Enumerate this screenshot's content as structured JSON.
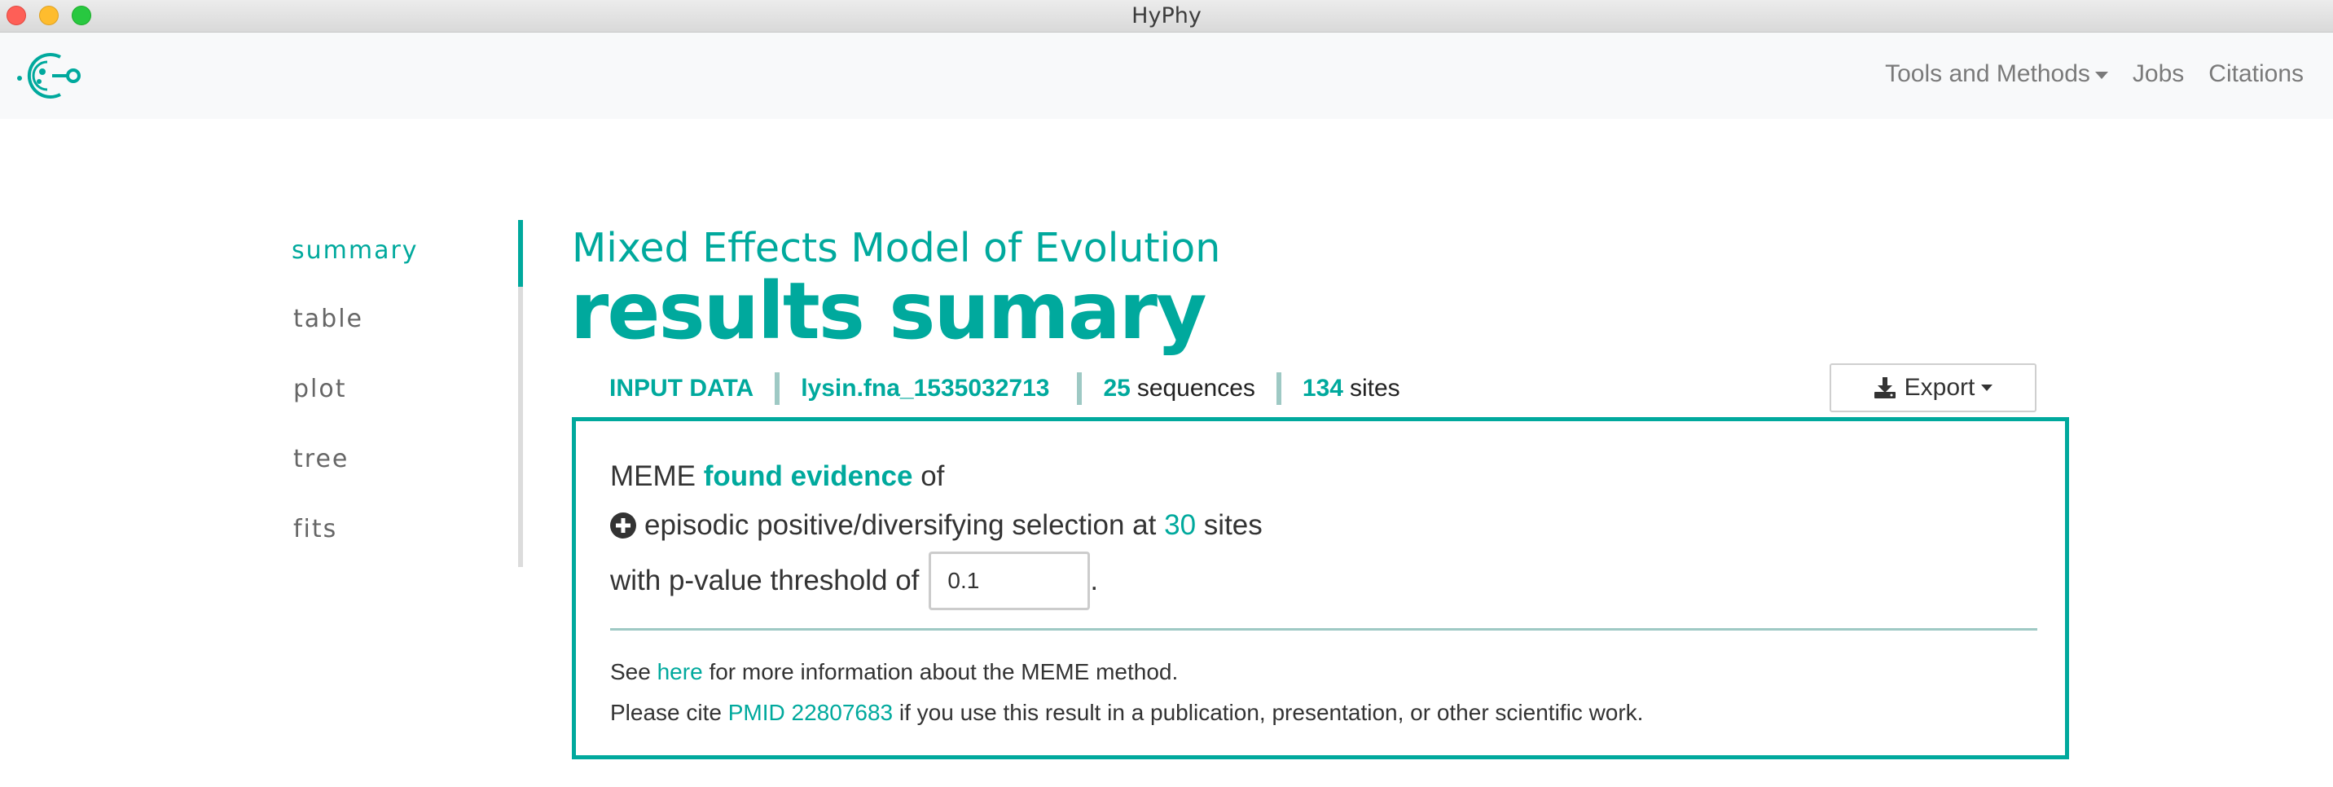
{
  "window": {
    "title": "HyPhy"
  },
  "navbar": {
    "logo_icon": "hyphy-logo-icon",
    "links": [
      {
        "label": "Tools and Methods",
        "dropdown": true
      },
      {
        "label": "Jobs"
      },
      {
        "label": "Citations"
      }
    ]
  },
  "sidenav": {
    "items": [
      {
        "label": "summary",
        "active": true
      },
      {
        "label": "table"
      },
      {
        "label": "plot"
      },
      {
        "label": "tree"
      },
      {
        "label": "fits"
      }
    ]
  },
  "header": {
    "subtitle": "Mixed Effects Model of Evolution",
    "title": "results sumary"
  },
  "input_data": {
    "label": "INPUT DATA",
    "filename": "lysin.fna_1535032713",
    "sequences_count": "25",
    "sequences_label": "sequences",
    "sites_count": "134",
    "sites_label": "sites"
  },
  "export": {
    "label": "Export",
    "icon": "download-icon"
  },
  "summary": {
    "line1_prefix": "MEME",
    "line1_highlight": "found evidence",
    "line1_suffix": "of",
    "line2_icon": "plus-circle-icon",
    "line2_text": "episodic positive/diversifying selection at",
    "line2_count": "30",
    "line2_suffix": "sites",
    "line3_text": "with p-value threshold of",
    "pvalue": "0.1",
    "line3_end": ".",
    "info_prefix": "See",
    "info_link": "here",
    "info_suffix": "for more information about the MEME method.",
    "cite_prefix": "Please cite",
    "cite_link": "PMID 22807683",
    "cite_suffix": "if you use this result in a publication, presentation, or other scientific work."
  },
  "colors": {
    "accent": "#00a99d",
    "divider": "#9ec9c4"
  }
}
